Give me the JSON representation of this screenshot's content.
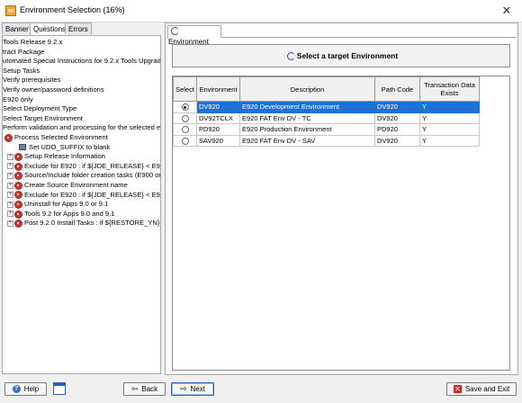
{
  "window": {
    "title": "Environment Selection (16%)",
    "close_glyph": "✕"
  },
  "left_tabs": [
    "Banner",
    "Questions",
    "Errors"
  ],
  "tree": [
    {
      "label": "Tools Release 9.2.x",
      "icon": "none"
    },
    {
      "label": "tract Package",
      "icon": "none"
    },
    {
      "label": "utomated Special Instructions for 9.2.x Tools Upgrade.",
      "icon": "none"
    },
    {
      "label": "Setup Tasks",
      "icon": "none"
    },
    {
      "label": "Verify prerequisites",
      "icon": "none"
    },
    {
      "label": "Verify owner/password definitions",
      "icon": "none"
    },
    {
      "label": "E920 only",
      "icon": "none"
    },
    {
      "label": "Select Deployment Type",
      "icon": "none"
    },
    {
      "label": "Select Target Environment",
      "icon": "none"
    },
    {
      "label": "Perform validation and processing for the selected en",
      "icon": "none"
    },
    {
      "label": "Process Selected Environment",
      "icon": "gear"
    },
    {
      "label": "Set UDO_SUFFIX to blank",
      "icon": "leaf"
    },
    {
      "label": "Setup Release Information",
      "icon": "gear"
    },
    {
      "label": "Exclude for E920 : if ${JDE_RELEASE} < E920",
      "icon": "gear"
    },
    {
      "label": "Source/Include folder creation tasks (E900 or",
      "icon": "gear"
    },
    {
      "label": "Create Source Environment name",
      "icon": "gear"
    },
    {
      "label": "Exclude for E920 : if ${JDE_RELEASE} < E920",
      "icon": "gear"
    },
    {
      "label": "Uninstall for Apps 9.0 or 9.1",
      "icon": "gear"
    },
    {
      "label": "Tools 9.2 for Apps 9.0 and 9.1",
      "icon": "gear"
    },
    {
      "label": "Post 9.2.0 Install Tasks : if ${RESTORE_YN}",
      "icon": "gear"
    }
  ],
  "right_tab": "Environment",
  "header": "Select a target Environment",
  "table": {
    "columns": [
      "Select",
      "Environment",
      "Description",
      "Path Code",
      "Transaction Data Exists"
    ],
    "rows": [
      {
        "selected": true,
        "environment": "DV920",
        "description": "E920 Development Environment",
        "path_code": "DV920",
        "transaction": "Y"
      },
      {
        "selected": false,
        "environment": "DV92TCLX",
        "description": "E920 FAT Env DV - TC",
        "path_code": "DV920",
        "transaction": "Y"
      },
      {
        "selected": false,
        "environment": "PD920",
        "description": "E920 Production Environment",
        "path_code": "PD920",
        "transaction": "Y"
      },
      {
        "selected": false,
        "environment": "SAV920",
        "description": "E920 FAT Env DV - SAV",
        "path_code": "DV920",
        "transaction": "Y"
      }
    ]
  },
  "buttons": {
    "help": "Help",
    "back": "Back",
    "next": "Next",
    "save_exit": "Save and Exit"
  },
  "icons": {
    "help": "?",
    "back": "⇦",
    "next": "⇨",
    "save_exit": "✕"
  },
  "colors": {
    "selection": "#1e72d6",
    "focus": "#2a62c9"
  }
}
